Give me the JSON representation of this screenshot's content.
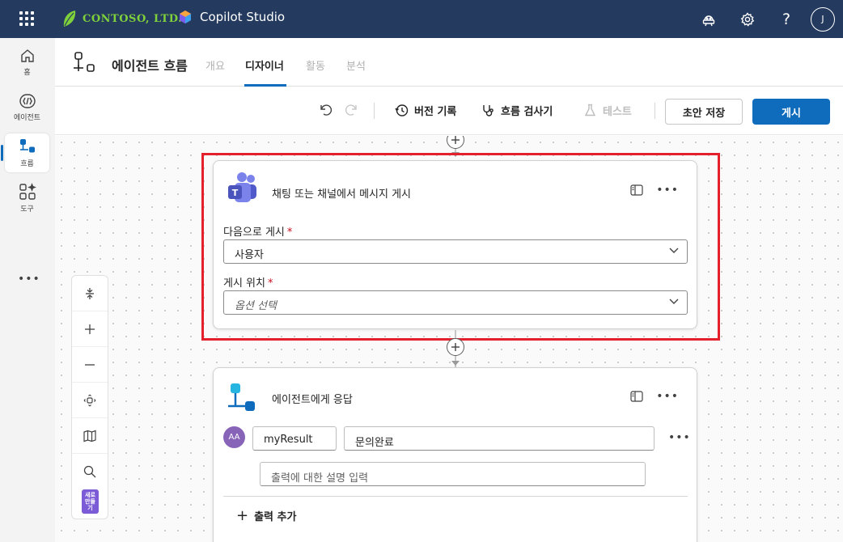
{
  "topbar": {
    "company": "CONTOSO, LTD.",
    "product": "Copilot Studio",
    "avatar_initial": "J",
    "icons": [
      "waffle-icon",
      "agent-icon",
      "settings-icon",
      "help-icon"
    ]
  },
  "rail": {
    "items": [
      {
        "label": "홈",
        "icon": "home-icon"
      },
      {
        "label": "에이전트",
        "icon": "agent-icon"
      },
      {
        "label": "흐름",
        "icon": "flow-icon"
      },
      {
        "label": "도구",
        "icon": "tools-icon"
      }
    ],
    "more": "•••"
  },
  "header": {
    "title": "에이전트 흐름",
    "tabs": [
      {
        "label": "개요"
      },
      {
        "label": "디자이너"
      },
      {
        "label": "활동"
      },
      {
        "label": "분석"
      }
    ],
    "active_tab": "디자이너"
  },
  "toolbar": {
    "version_history": "버전 기록",
    "flow_checker": "흐름 검사기",
    "test": "테스트",
    "save_draft": "초안 저장",
    "publish": "게시"
  },
  "canvas": {
    "card1": {
      "title": "채팅 또는 채널에서 메시지 게시",
      "post_as_label": "다음으로 게시",
      "post_as_value": "사용자",
      "post_in_label": "게시 위치",
      "post_in_placeholder": "옵션 선택",
      "required_mark": "*"
    },
    "card2": {
      "title": "에이전트에게 응답",
      "avatar_text": "AA",
      "output_name": "myResult",
      "output_value": "문의완료",
      "description_placeholder": "출력에 대한 설명 입력",
      "add_output": "출력 추가"
    },
    "new_badge": "새로\n만들\n기"
  },
  "colors": {
    "topbar": "#243a5e",
    "accent": "#0f6cbd",
    "highlight": "#e3202b",
    "brand_green": "#7fd13b"
  }
}
